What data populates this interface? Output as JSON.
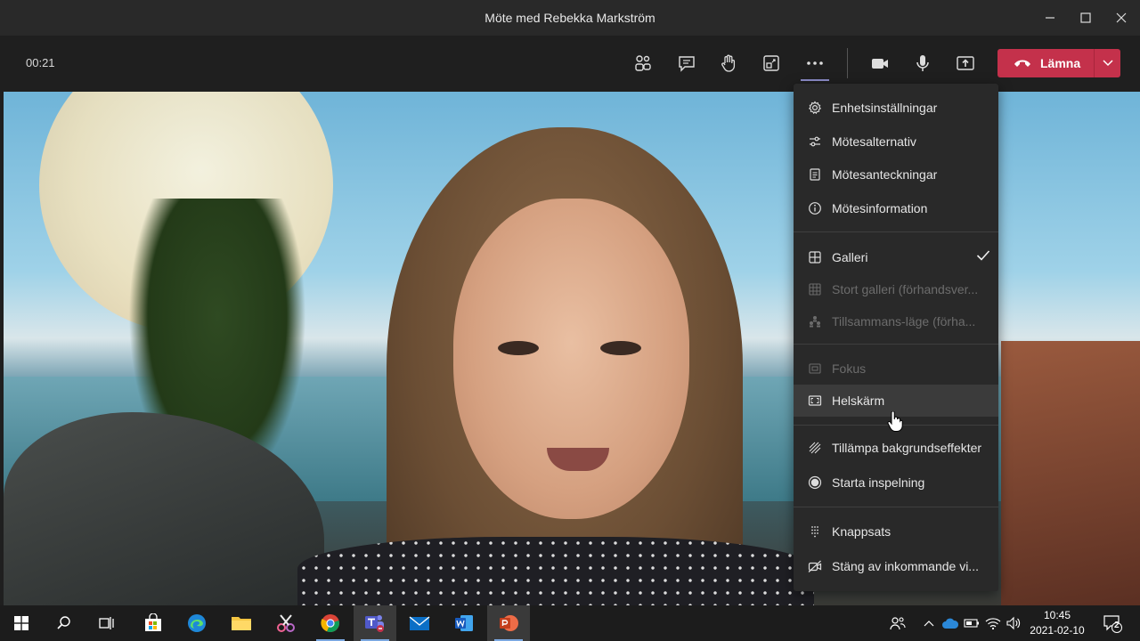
{
  "window": {
    "title": "Möte med Rebekka Markström"
  },
  "toolbar": {
    "timer": "00:21",
    "leave_label": "Lämna"
  },
  "menu": {
    "items": [
      {
        "label": "Enhetsinställningar",
        "icon": "gear-icon",
        "disabled": false
      },
      {
        "label": "Mötesalternativ",
        "icon": "sliders-icon",
        "disabled": false
      },
      {
        "label": "Mötesanteckningar",
        "icon": "notes-icon",
        "disabled": false
      },
      {
        "label": "Mötesinformation",
        "icon": "info-icon",
        "disabled": false
      },
      {
        "label": "Galleri",
        "icon": "grid-icon",
        "disabled": false,
        "checked": true
      },
      {
        "label": "Stort galleri (förhandsver...",
        "icon": "large-grid-icon",
        "disabled": true
      },
      {
        "label": "Tillsammans-läge (förha...",
        "icon": "together-icon",
        "disabled": true
      },
      {
        "label": "Fokus",
        "icon": "focus-icon",
        "disabled": true
      },
      {
        "label": "Helskärm",
        "icon": "fullscreen-icon",
        "disabled": false,
        "hover": true
      },
      {
        "label": "Tillämpa bakgrundseffekter",
        "icon": "background-effects-icon",
        "disabled": false
      },
      {
        "label": "Starta inspelning",
        "icon": "record-icon",
        "disabled": false
      },
      {
        "label": "Knappsats",
        "icon": "dialpad-icon",
        "disabled": false
      },
      {
        "label": "Stäng av inkommande vi...",
        "icon": "video-off-icon",
        "disabled": false
      }
    ]
  },
  "taskbar": {
    "time": "10:45",
    "date": "2021-02-10",
    "notification_count": "2"
  },
  "colors": {
    "leave": "#c4314b",
    "accent": "#8b8cc7",
    "menu_bg": "#292929"
  }
}
